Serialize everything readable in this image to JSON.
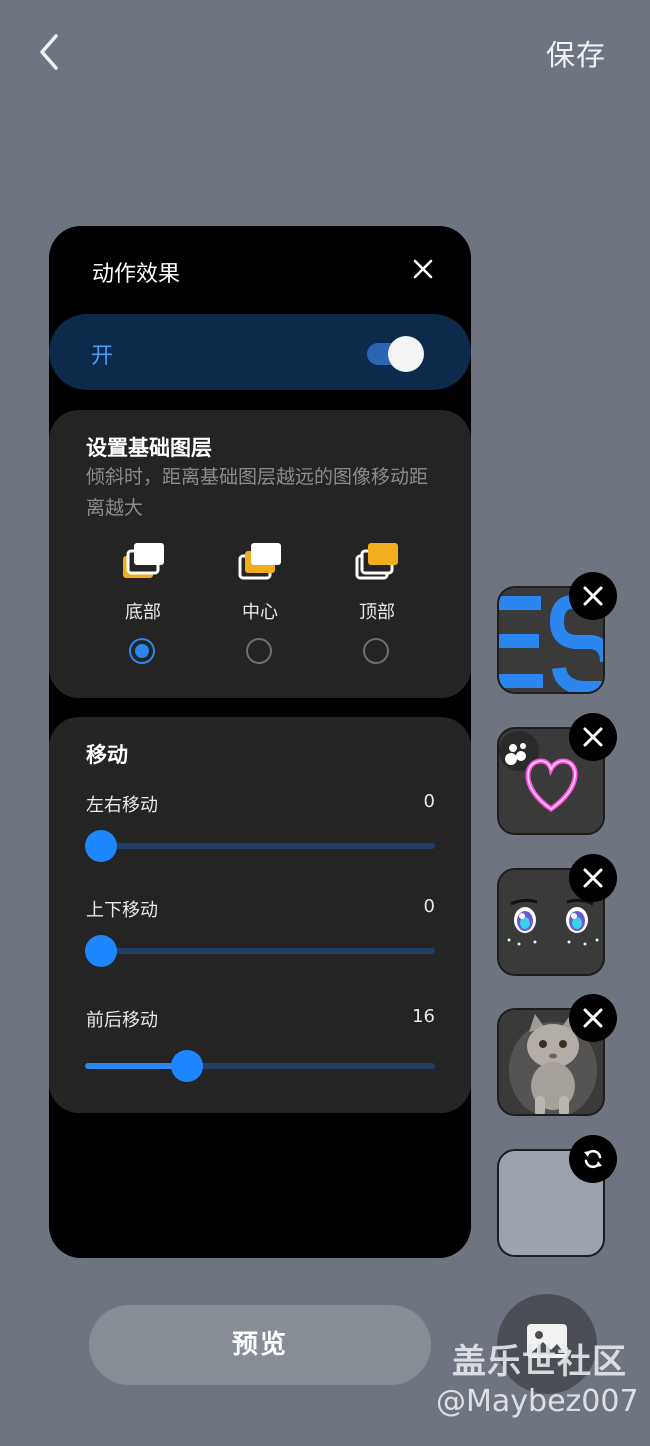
{
  "header": {
    "save_label": "保存"
  },
  "panel": {
    "title": "动作效果",
    "toggle": {
      "label": "开",
      "on": true
    },
    "base_layer": {
      "title": "设置基础图层",
      "description": "倾斜时，距离基础图层越远的图像移动距离越大",
      "options": [
        {
          "label": "底部",
          "selected": true
        },
        {
          "label": "中心",
          "selected": false
        },
        {
          "label": "顶部",
          "selected": false
        }
      ]
    },
    "movement": {
      "title": "移动",
      "sliders": [
        {
          "label": "左右移动",
          "value": "0",
          "fraction": 0.0
        },
        {
          "label": "上下移动",
          "value": "0",
          "fraction": 0.0
        },
        {
          "label": "前后移动",
          "value": "16",
          "fraction": 0.29
        }
      ]
    }
  },
  "thumbnails": [
    {
      "name": "es-letters-thumb",
      "badge": "remove"
    },
    {
      "name": "neon-heart-thumb",
      "badge": "remove"
    },
    {
      "name": "anime-eyes-thumb",
      "badge": "remove"
    },
    {
      "name": "kitten-thumb",
      "badge": "remove"
    },
    {
      "name": "background-thumb",
      "badge": "refresh"
    }
  ],
  "footer": {
    "preview_label": "预览"
  },
  "watermark": {
    "site": "盖乐世社区",
    "user": "@Maybez007"
  },
  "colors": {
    "accent": "#2b86f0",
    "page_bg": "#6e7580",
    "panel_bg": "#000000",
    "card_bg": "#242424",
    "toggle_bg": "#0b2a4c"
  }
}
